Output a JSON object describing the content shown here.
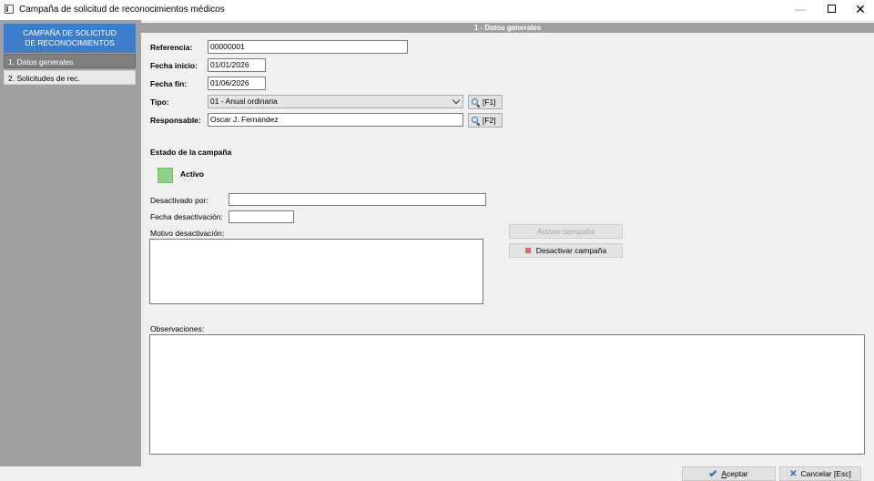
{
  "window": {
    "title": "Campaña de solicitud de reconocimientos médicos"
  },
  "sidebar": {
    "header_line1": "CAMPAÑA DE SOLICITUD",
    "header_line2": "DE RECONOCIMIENTOS",
    "items": [
      {
        "label": "1. Datos generales",
        "active": true
      },
      {
        "label": "2. Solicitudes de rec.",
        "active": false
      }
    ]
  },
  "section": {
    "title": "1 - Datos generales"
  },
  "form": {
    "referencia": {
      "label": "Referencia:",
      "value": "00000001"
    },
    "fecha_inicio": {
      "label": "Fecha inicio:",
      "value": "01/01/2026"
    },
    "fecha_fin": {
      "label": "Fecha fin:",
      "value": "01/06/2026"
    },
    "tipo": {
      "label": "Tipo:",
      "value": "01 - Anual ordinaria",
      "lookup": "[F1]"
    },
    "responsable": {
      "label": "Responsable:",
      "value": "Oscar J. Fernández",
      "lookup": "[F2]"
    }
  },
  "estado": {
    "heading": "Estado de la campaña",
    "status": "Activo",
    "status_color": "#8fcf8a",
    "desactivado_por_label": "Desactivado por:",
    "desactivado_por_value": "",
    "fecha_desactivacion_label": "Fecha desactivación:",
    "fecha_desactivacion_value": "",
    "motivo_label": "Motivo desactivación:",
    "motivo_value": "",
    "activar_label": "Activar campaña",
    "desactivar_label": "Desactivar campaña"
  },
  "observaciones": {
    "label": "Observaciones:",
    "value": ""
  },
  "footer": {
    "aceptar_first": "A",
    "aceptar_rest": "ceptar",
    "cancelar_label": "Cancelar [Esc]"
  },
  "colors": {
    "sidebar_header": "#3d7cc9",
    "sidebar_bg": "#a0a0a0",
    "section_header": "#a0a0a0"
  }
}
